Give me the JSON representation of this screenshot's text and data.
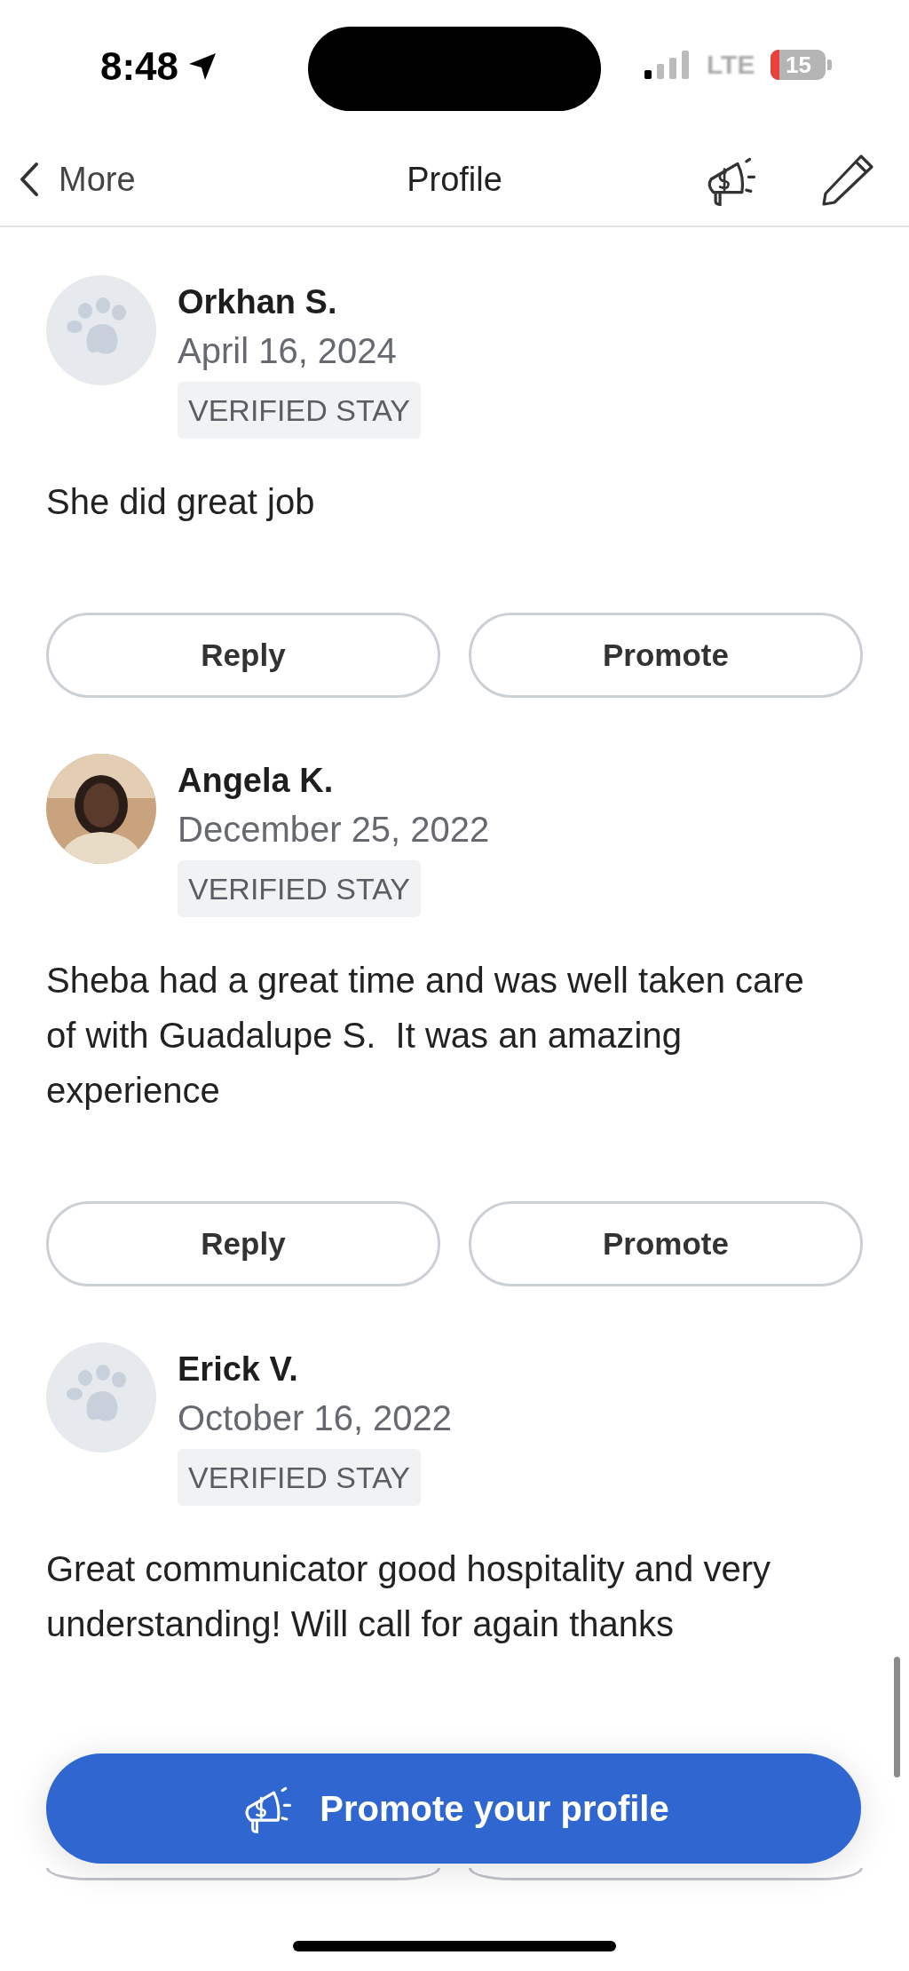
{
  "status_bar": {
    "time": "8:48",
    "network": "LTE",
    "battery": "15"
  },
  "nav": {
    "back_label": "More",
    "title": "Profile"
  },
  "reviews": [
    {
      "name": "Orkhan S.",
      "date": "April 16, 2024",
      "badge": "VERIFIED STAY",
      "has_photo": false,
      "text": "She did great job",
      "buttons_covered": false,
      "buttons": [
        "Reply",
        "Promote"
      ]
    },
    {
      "name": "Angela K.",
      "date": "December 25, 2022",
      "badge": "VERIFIED STAY",
      "has_photo": true,
      "text": "Sheba had a great time and was well taken care of with Guadalupe S.  It was an amazing experience",
      "buttons_covered": false,
      "buttons": [
        "Reply",
        "Promote"
      ]
    },
    {
      "name": "Erick V.",
      "date": "October 16, 2022",
      "badge": "VERIFIED STAY",
      "has_photo": false,
      "text": "Great communicator good hospitality and very understanding! Will call for again thanks",
      "buttons_covered": true
    }
  ],
  "promote_button": {
    "label": "Promote your profile"
  }
}
